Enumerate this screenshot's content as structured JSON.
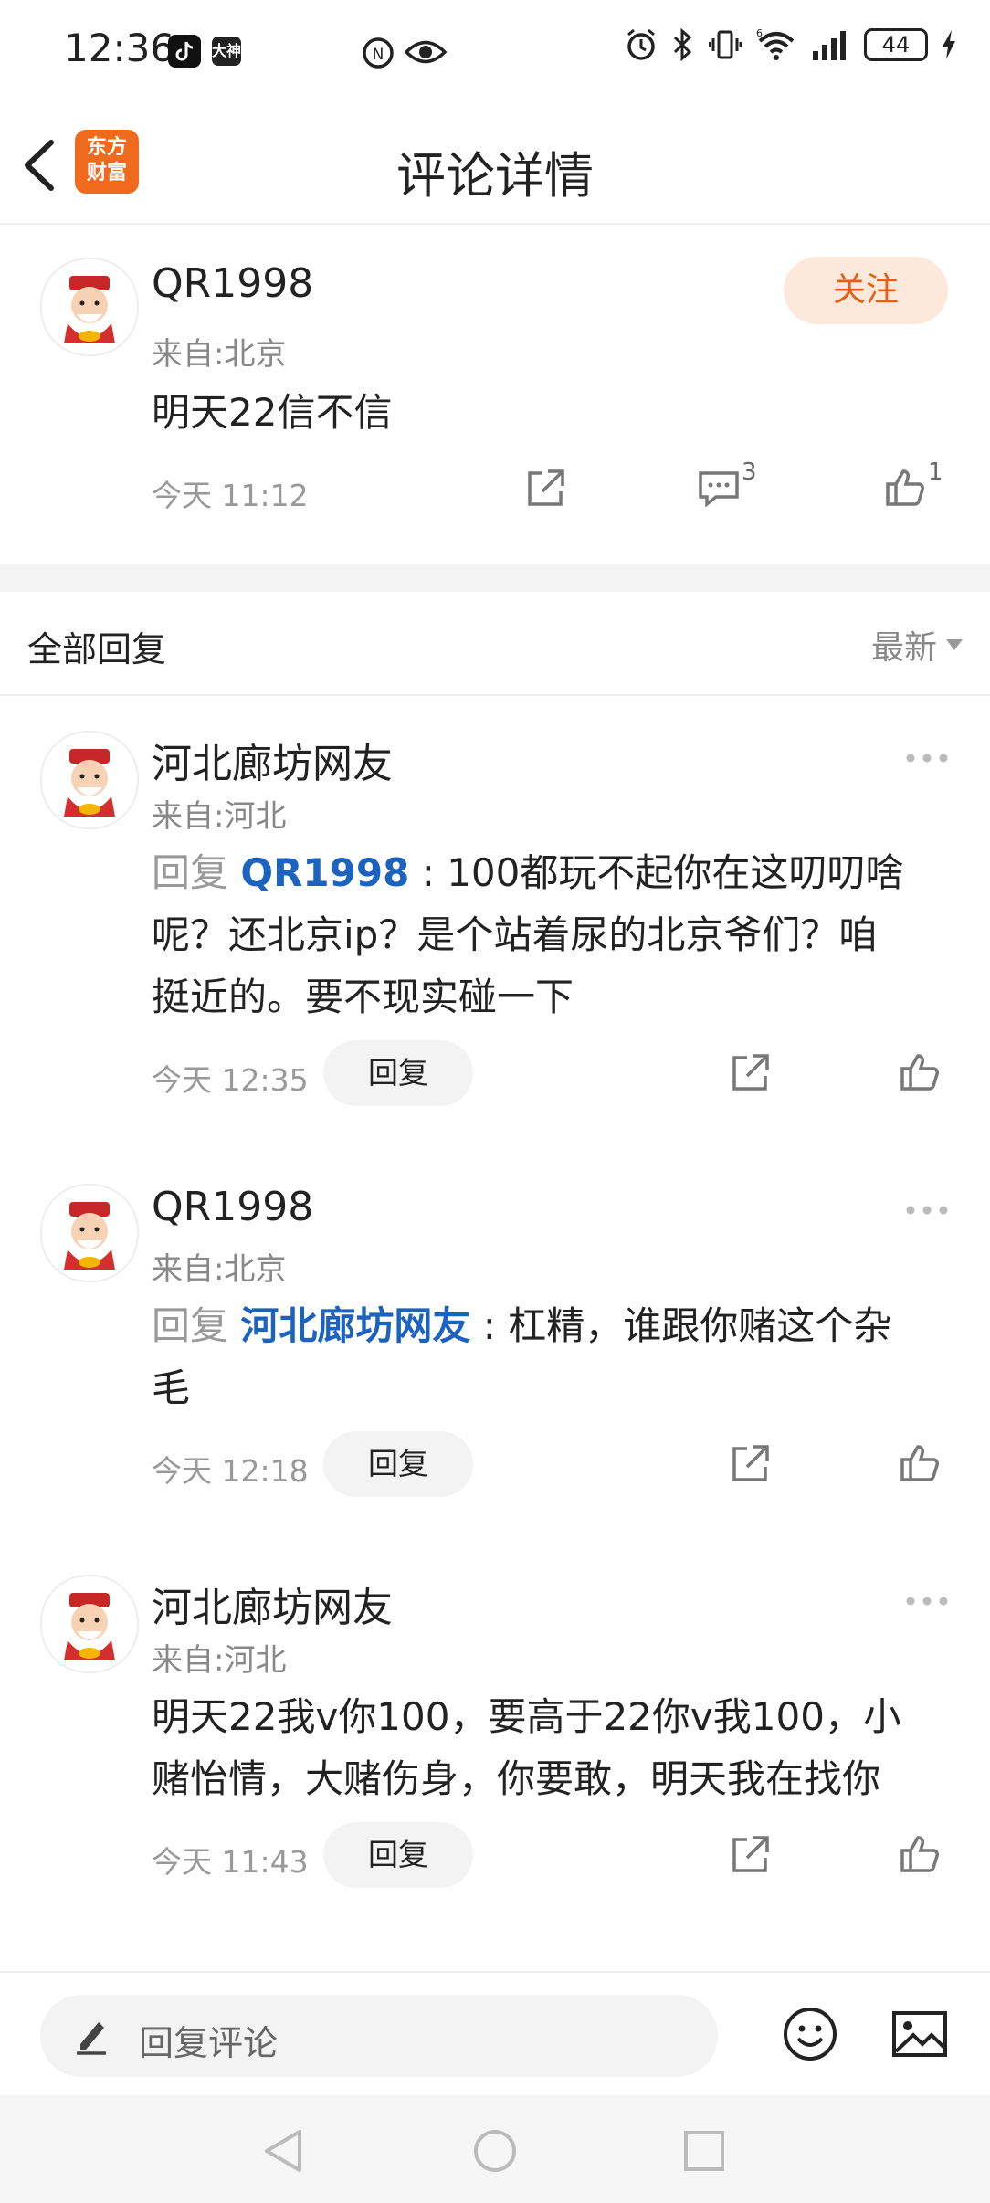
{
  "status_bar": {
    "time": "12:36",
    "app_badge_label": "大神",
    "battery": "44"
  },
  "header": {
    "title": "评论详情",
    "logo_text_line1": "东方",
    "logo_text_line2": "财富"
  },
  "post": {
    "author": "QR1998",
    "location": "来自:北京",
    "content": "明天22信不信",
    "time": "今天 11:12",
    "follow_label": "关注",
    "comment_count": "3",
    "like_count": "1"
  },
  "replies_section": {
    "title": "全部回复",
    "sort_label": "最新"
  },
  "replies": [
    {
      "author": "河北廊坊网友",
      "location": "来自:河北",
      "reply_prefix": "回复",
      "reply_target": "QR1998",
      "lines": [
        ": 100都玩不起你在这叨叨啥",
        "呢？还北京ip？是个站着尿的北京爷们？咱",
        "挺近的。要不现实碰一下"
      ],
      "time": "今天 12:35",
      "reply_label": "回复"
    },
    {
      "author": "QR1998",
      "location": "来自:北京",
      "reply_prefix": "回复",
      "reply_target": "河北廊坊网友",
      "lines": [
        ": 杠精，谁跟你赌这个杂",
        "毛"
      ],
      "time": "今天 12:18",
      "reply_label": "回复"
    },
    {
      "author": "河北廊坊网友",
      "location": "来自:河北",
      "lines": [
        "明天22我v你100，要高于22你v我100，小",
        "赌怡情，大赌伤身，你要敢，明天我在找你"
      ],
      "time": "今天 11:43",
      "reply_label": "回复"
    }
  ],
  "bottom_bar": {
    "input_placeholder": "回复评论"
  },
  "colors": {
    "accent_orange": "#e85d16",
    "link_blue": "#1c63c0"
  }
}
